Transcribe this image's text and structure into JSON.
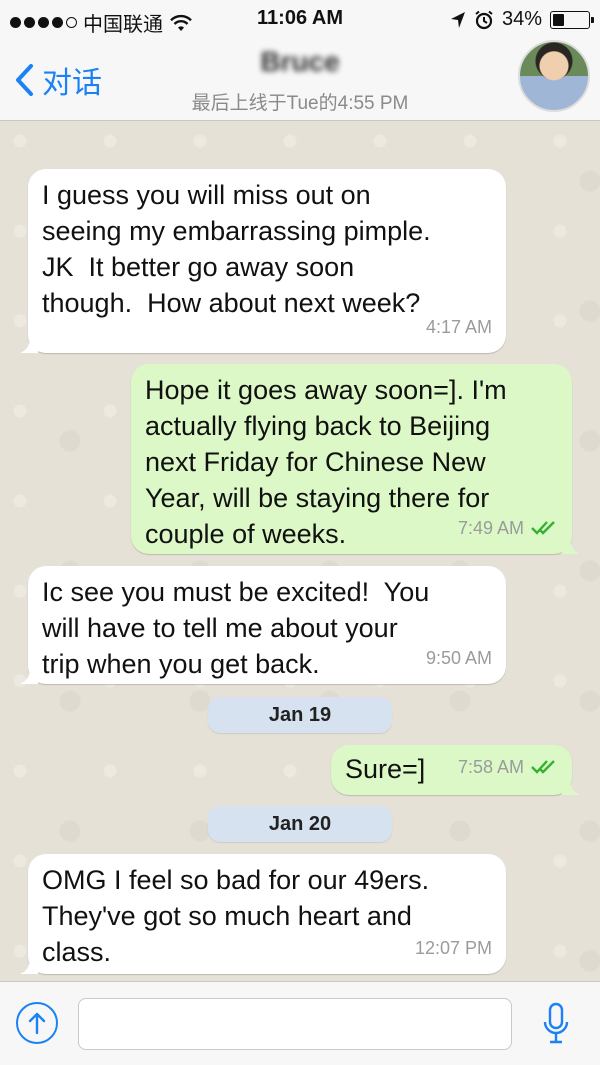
{
  "status_bar": {
    "carrier": "中国联通",
    "time": "11:06 AM",
    "battery": "34%",
    "battery_level": 0.34,
    "signal_bars_filled": 4,
    "signal_bars_total": 5
  },
  "nav": {
    "back_label": "对话",
    "contact_name": "Bruce",
    "last_seen": "最后上线于Tue的4:55 PM"
  },
  "messages": [
    {
      "direction": "in",
      "text": "I guess you will miss out on\nseeing my embarrassing pimple.\nJK  It better go away soon\nthough.  How about next week?",
      "time": "4:17 AM"
    },
    {
      "direction": "out",
      "text": "Hope it goes away soon=]. I'm\nactually flying back to Beijing\nnext Friday for Chinese New\nYear, will be staying there for\ncouple of weeks.",
      "time": "7:49 AM",
      "read": true
    },
    {
      "direction": "in",
      "text": "Ic see you must be excited!  You\nwill have to tell me about your\ntrip when you get back.",
      "time": "9:50 AM"
    },
    {
      "direction": "out",
      "text": "Sure=]",
      "time": "7:58 AM",
      "read": true
    },
    {
      "direction": "in",
      "text": "OMG I feel so bad for our 49ers.\nThey've got so much heart and\nclass.",
      "time": "12:07 PM"
    }
  ],
  "date_separators": [
    "Jan 19",
    "Jan 20"
  ],
  "input": {
    "value": "",
    "placeholder": ""
  },
  "colors": {
    "accent": "#1a82f5",
    "incoming_bubble": "#ffffff",
    "outgoing_bubble": "#dcf8c6",
    "read_check": "#34b233",
    "date_pill": "#d7e2f0"
  }
}
